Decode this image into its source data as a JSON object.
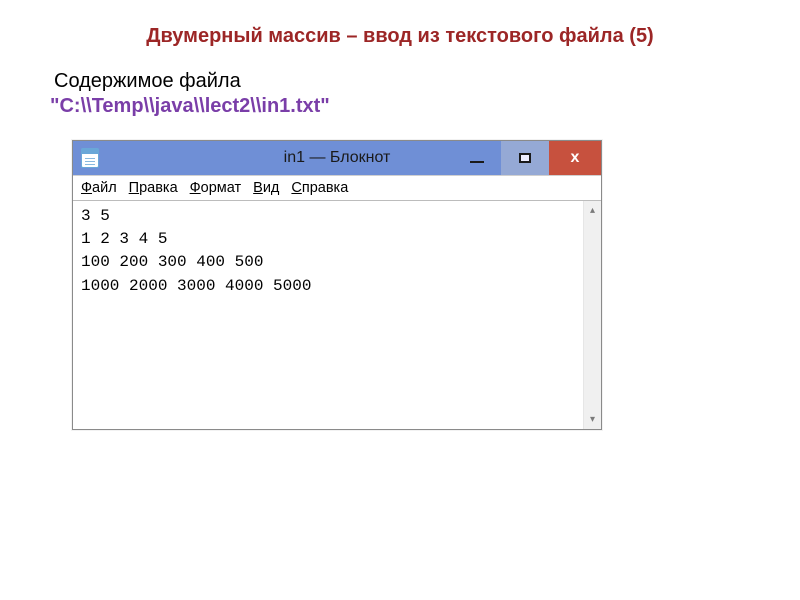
{
  "slide": {
    "title": "Двумерный массив – ввод из текстового файла (5)",
    "intro": "Содержимое файла",
    "path": "\"C:\\\\Temp\\\\java\\\\lect2\\\\in1.txt\""
  },
  "notepad": {
    "title": "in1 — Блокнот",
    "menus": {
      "file": {
        "u": "Ф",
        "rest": "айл"
      },
      "edit": {
        "u": "П",
        "rest": "равка"
      },
      "format": {
        "u": "Ф",
        "rest": "ормат"
      },
      "view": {
        "u": "В",
        "rest": "ид"
      },
      "help": {
        "u": "С",
        "rest": "правка"
      }
    },
    "content_lines": [
      "3 5",
      "1 2 3 4 5",
      "100 200 300 400 500",
      "1000 2000 3000 4000 5000"
    ],
    "close_glyph": "x"
  }
}
